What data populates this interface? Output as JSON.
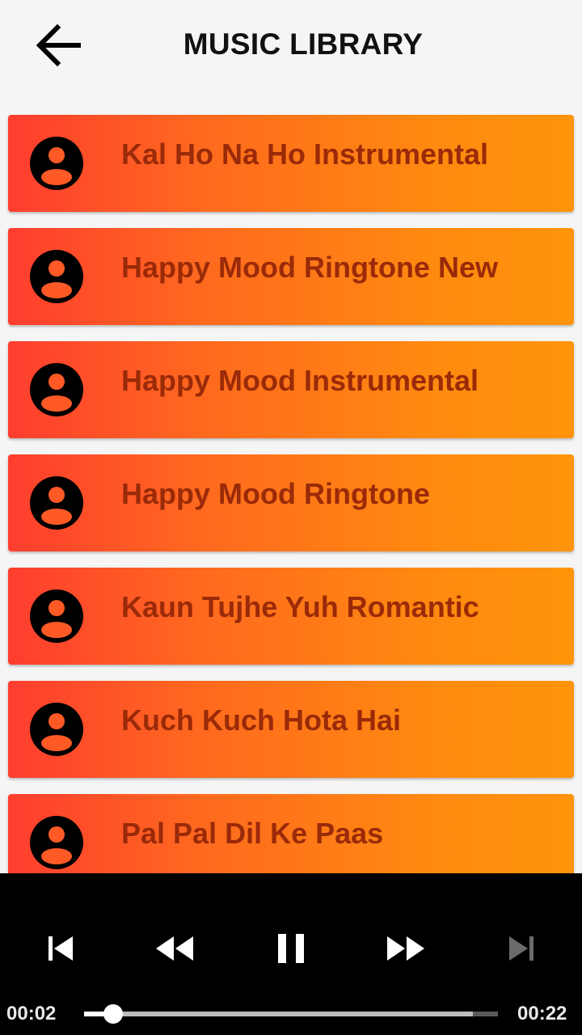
{
  "header": {
    "title": "MUSIC LIBRARY",
    "back_icon": "arrow-back-icon"
  },
  "songs": [
    {
      "title": "Kal Ho Na Ho Instrumental",
      "icon": "account-circle-icon"
    },
    {
      "title": "Happy Mood Ringtone New",
      "icon": "account-circle-icon"
    },
    {
      "title": "Happy Mood Instrumental",
      "icon": "account-circle-icon"
    },
    {
      "title": "Happy Mood Ringtone",
      "icon": "account-circle-icon"
    },
    {
      "title": "Kaun Tujhe Yuh Romantic",
      "icon": "account-circle-icon"
    },
    {
      "title": "Kuch Kuch Hota Hai",
      "icon": "account-circle-icon"
    },
    {
      "title": "Pal Pal Dil Ke Paas",
      "icon": "account-circle-icon"
    }
  ],
  "player": {
    "elapsed": "00:02",
    "duration": "00:22",
    "progress": 0.07,
    "buffered": 0.94,
    "state": "playing",
    "controls": [
      "skip-previous-icon",
      "rewind-icon",
      "pause-icon",
      "fast-forward-icon",
      "skip-next-icon"
    ],
    "next_disabled": true
  },
  "colors": {
    "card_gradient_start": "#ff3d2f",
    "card_gradient_end": "#ff940a",
    "song_text": "#9a2a08",
    "player_bg": "#000000"
  }
}
